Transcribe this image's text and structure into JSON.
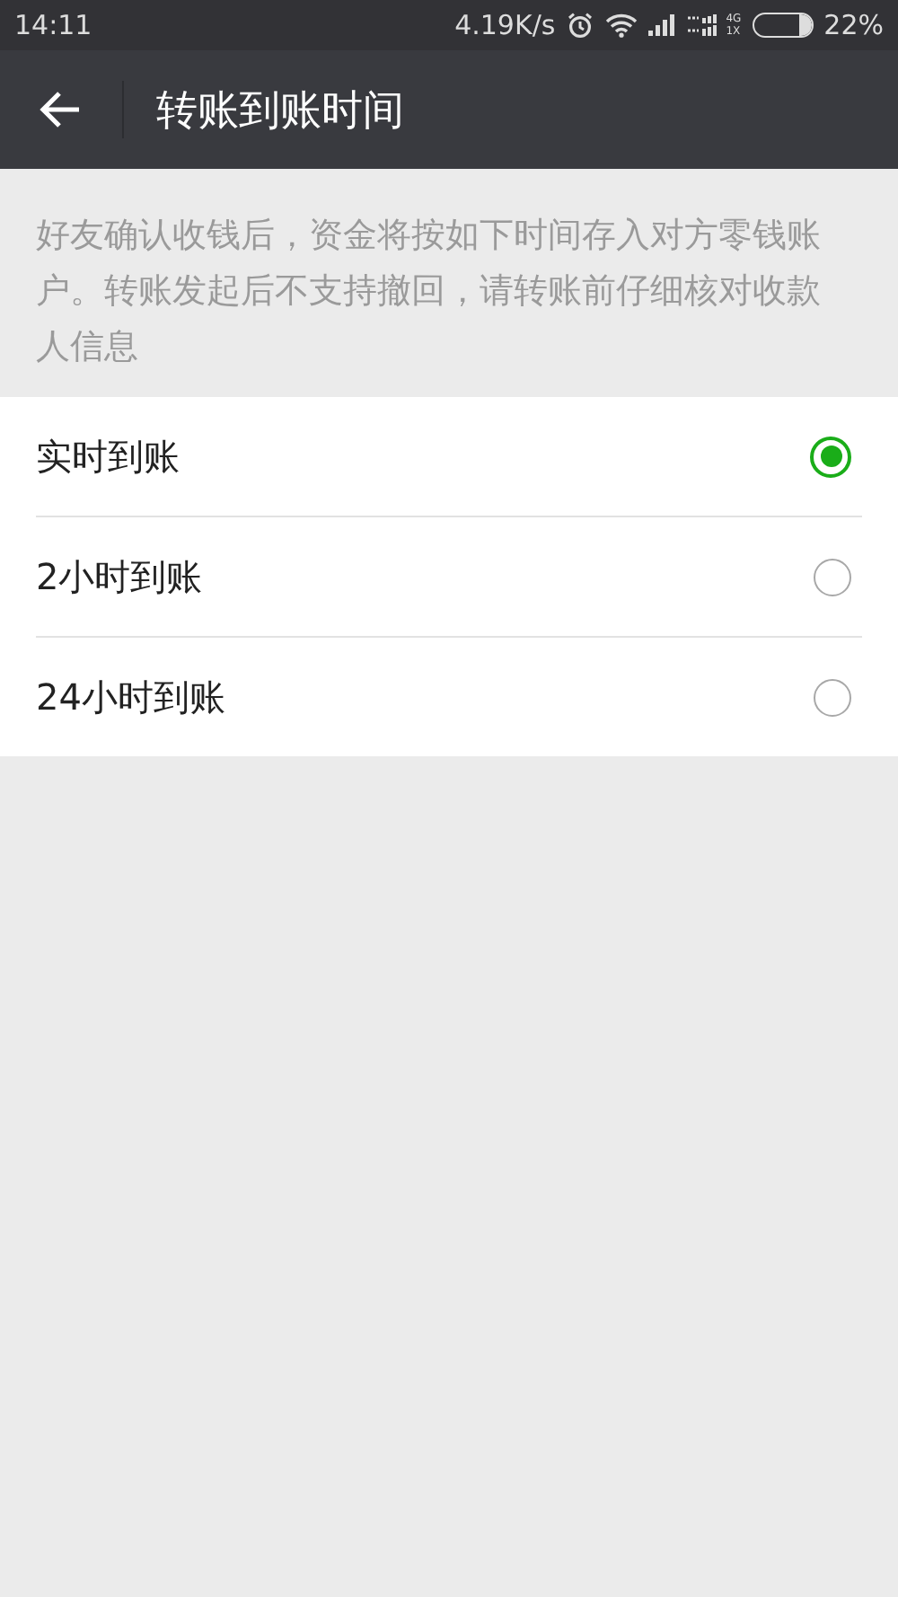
{
  "status_bar": {
    "time": "14:11",
    "speed": "4.19K/s",
    "network_top": "4G",
    "network_bottom": "1X",
    "battery": "22%"
  },
  "header": {
    "title": "转账到账时间"
  },
  "description": "好友确认收钱后，资金将按如下时间存入对方零钱账户。转账发起后不支持撤回，请转账前仔细核对收款人信息",
  "options": [
    {
      "label": "实时到账",
      "selected": true
    },
    {
      "label": "2小时到账",
      "selected": false
    },
    {
      "label": "24小时到账",
      "selected": false
    }
  ]
}
